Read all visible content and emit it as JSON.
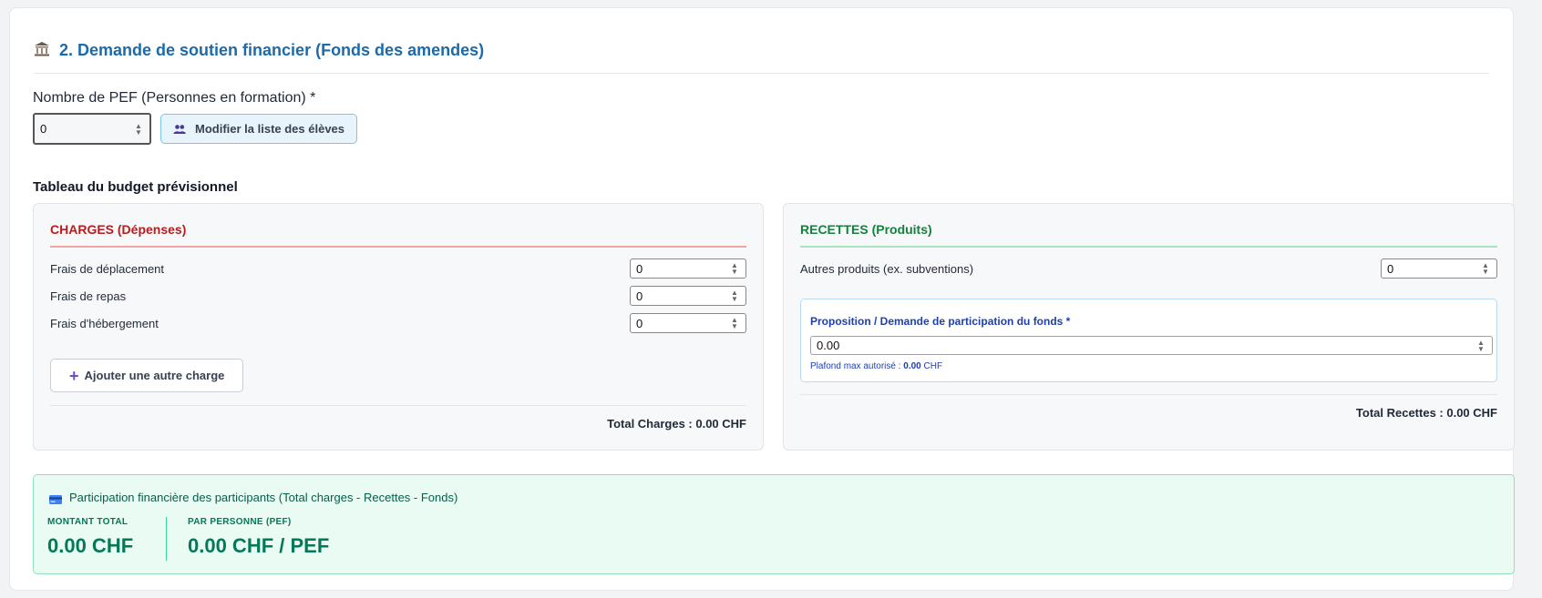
{
  "section": {
    "title": "2. Demande de soutien financier (Fonds des amendes)",
    "icon": "bank-icon"
  },
  "pef": {
    "label": "Nombre de PEF (Personnes en formation) *",
    "value": "0",
    "modify_button": "Modifier la liste des élèves"
  },
  "budget": {
    "title": "Tableau du budget prévisionnel",
    "charges": {
      "heading": "CHARGES (Dépenses)",
      "items": [
        {
          "label": "Frais de déplacement",
          "value": "0"
        },
        {
          "label": "Frais de repas",
          "value": "0"
        },
        {
          "label": "Frais d'hébergement",
          "value": "0"
        }
      ],
      "add_button": "Ajouter une autre charge",
      "total": "Total Charges : 0.00 CHF"
    },
    "recettes": {
      "heading": "RECETTES (Produits)",
      "other_label": "Autres produits (ex. subventions)",
      "other_value": "0",
      "fund_label": "Proposition / Demande de participation du fonds *",
      "fund_value": "0.00",
      "fund_hint_prefix": "Plafond max autorisé :",
      "fund_hint_amount": "0.00",
      "fund_hint_currency": "CHF",
      "total": "Total Recettes : 0.00 CHF"
    }
  },
  "participation": {
    "title": "Participation financière des participants (Total charges - Recettes - Fonds)",
    "total_label": "MONTANT TOTAL",
    "total_value": "0.00 CHF",
    "per_label": "PAR PERSONNE (PEF)",
    "per_value": "0.00 CHF / PEF"
  },
  "colors": {
    "title_blue": "#1c6aa8",
    "charges_red": "#b91c1c",
    "recettes_green": "#15803d",
    "participation_green": "#047857"
  }
}
